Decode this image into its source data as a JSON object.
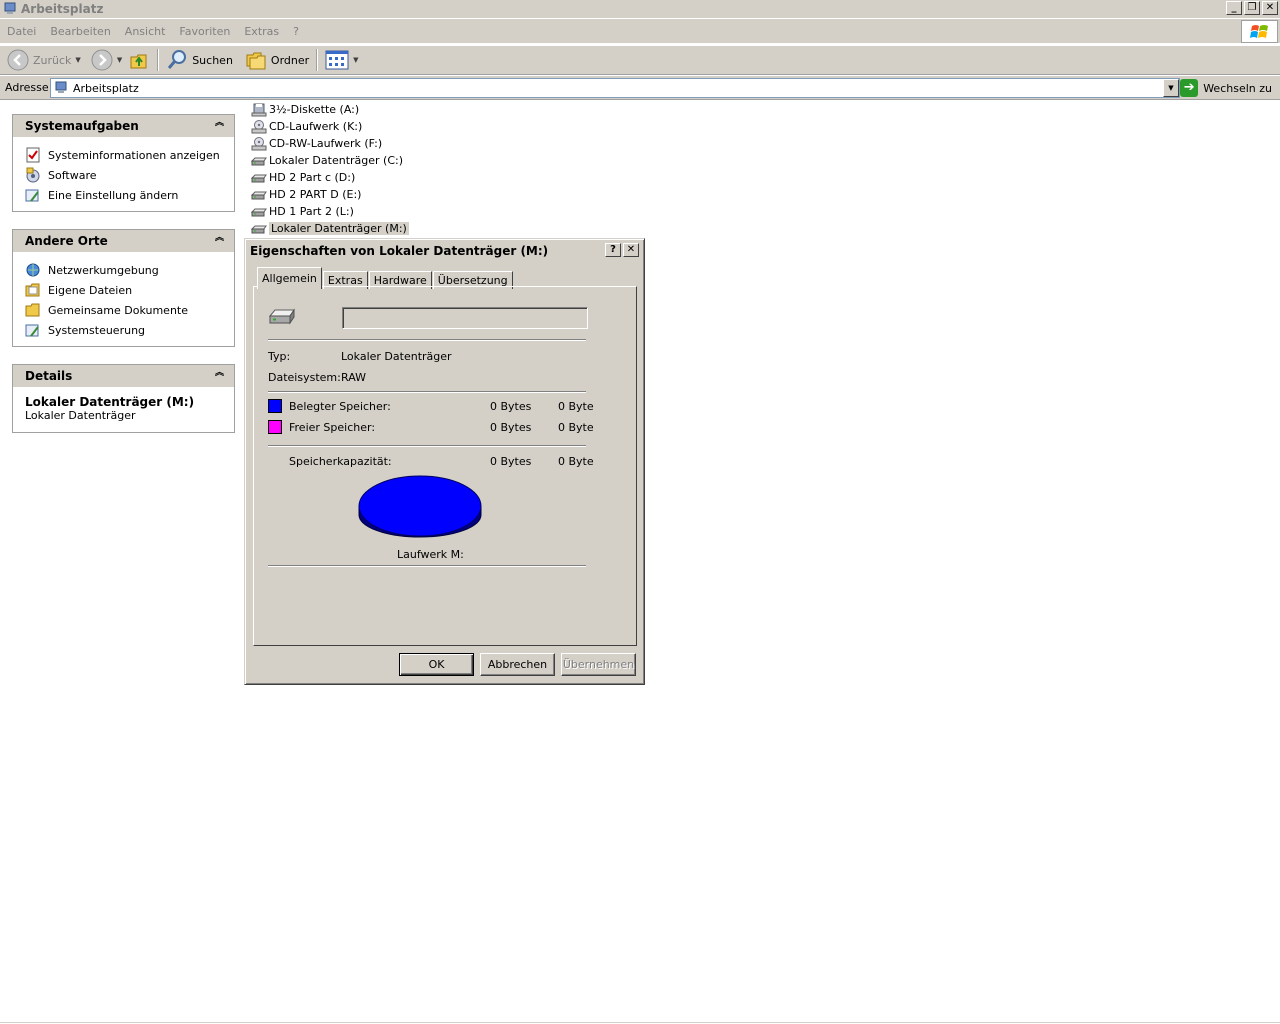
{
  "window": {
    "title": "Arbeitsplatz"
  },
  "caption_buttons": {
    "minimize": "_",
    "restore": "❐",
    "close": "✕"
  },
  "menu": {
    "items": [
      "Datei",
      "Bearbeiten",
      "Ansicht",
      "Favoriten",
      "Extras",
      "?"
    ]
  },
  "toolbar": {
    "back_label": "Zurück",
    "search_label": "Suchen",
    "folders_label": "Ordner"
  },
  "address": {
    "label": "Adresse",
    "value": "Arbeitsplatz",
    "go_label": "Wechseln zu"
  },
  "system_tasks": {
    "title": "Systemaufgaben",
    "items": [
      "Systeminformationen anzeigen",
      "Software",
      "Eine Einstellung ändern"
    ]
  },
  "other_places": {
    "title": "Andere Orte",
    "items": [
      "Netzwerkumgebung",
      "Eigene Dateien",
      "Gemeinsame Dokumente",
      "Systemsteuerung"
    ]
  },
  "details": {
    "title": "Details",
    "name": "Lokaler Datenträger (M:)",
    "type": "Lokaler Datenträger"
  },
  "drives": [
    {
      "label": "3½-Diskette (A:)",
      "icon": "floppy-icon"
    },
    {
      "label": "CD-Laufwerk (K:)",
      "icon": "cd-drive-icon"
    },
    {
      "label": "CD-RW-Laufwerk (F:)",
      "icon": "cd-drive-icon"
    },
    {
      "label": "Lokaler Datenträger (C:)",
      "icon": "hard-drive-icon"
    },
    {
      "label": "HD 2 Part c (D:)",
      "icon": "hard-drive-icon"
    },
    {
      "label": "HD 2 PART D (E:)",
      "icon": "hard-drive-icon"
    },
    {
      "label": "HD 1 Part 2 (L:)",
      "icon": "hard-drive-icon"
    },
    {
      "label": "Lokaler Datenträger (M:)",
      "icon": "hard-drive-icon",
      "selected": true
    }
  ],
  "dialog": {
    "title": "Eigenschaften von Lokaler Datenträger (M:)",
    "help_btn": "?",
    "close_btn": "✕",
    "tabs": [
      "Allgemein",
      "Extras",
      "Hardware",
      "Übersetzung"
    ],
    "active_tab": "Allgemein",
    "volume_label_value": "",
    "type_label": "Typ:",
    "type_value": "Lokaler Datenträger",
    "fs_label": "Dateisystem:",
    "fs_value": "RAW",
    "used_label": "Belegter Speicher:",
    "used_bytes": "0 Bytes",
    "used_size": "0 Byte",
    "free_label": "Freier Speicher:",
    "free_bytes": "0 Bytes",
    "free_size": "0 Byte",
    "capacity_label": "Speicherkapazität:",
    "capacity_bytes": "0 Bytes",
    "capacity_size": "0 Byte",
    "drive_caption": "Laufwerk M:",
    "buttons": {
      "ok": "OK",
      "cancel": "Abbrechen",
      "apply": "Übernehmen"
    },
    "colors": {
      "used": "#0000ff",
      "free": "#ff00ff",
      "pie_side": "#000080"
    }
  }
}
